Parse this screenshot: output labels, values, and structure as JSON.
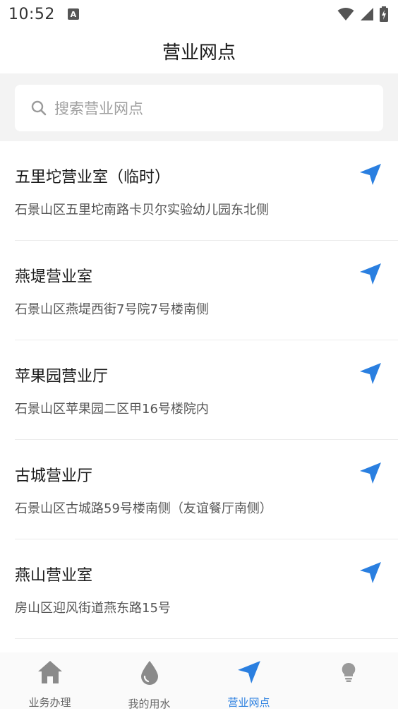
{
  "status_bar": {
    "time": "10:52",
    "notification_badge": "A"
  },
  "header": {
    "title": "营业网点"
  },
  "search": {
    "placeholder": "搜索营业网点"
  },
  "outlets": [
    {
      "name": "五里坨营业室（临时）",
      "address": "石景山区五里坨南路卡贝尔实验幼儿园东北侧"
    },
    {
      "name": "燕堤营业室",
      "address": "石景山区燕堤西街7号院7号楼南侧"
    },
    {
      "name": "苹果园营业厅",
      "address": "石景山区苹果园二区甲16号楼院内"
    },
    {
      "name": "古城营业厅",
      "address": "石景山区古城路59号楼南侧（友谊餐厅南侧）"
    },
    {
      "name": "燕山营业室",
      "address": "房山区迎风街道燕东路15号"
    }
  ],
  "tabs": [
    {
      "label": "业务办理",
      "icon": "home-icon",
      "active": false
    },
    {
      "label": "我的用水",
      "icon": "water-drop-icon",
      "active": false
    },
    {
      "label": "营业网点",
      "icon": "navigation-arrow-icon",
      "active": true
    },
    {
      "label": "",
      "icon": "lightbulb-icon",
      "active": false
    }
  ],
  "colors": {
    "accent": "#2a7fe0",
    "icon_gray": "#8a8a8a",
    "background": "#f3f3f3"
  }
}
